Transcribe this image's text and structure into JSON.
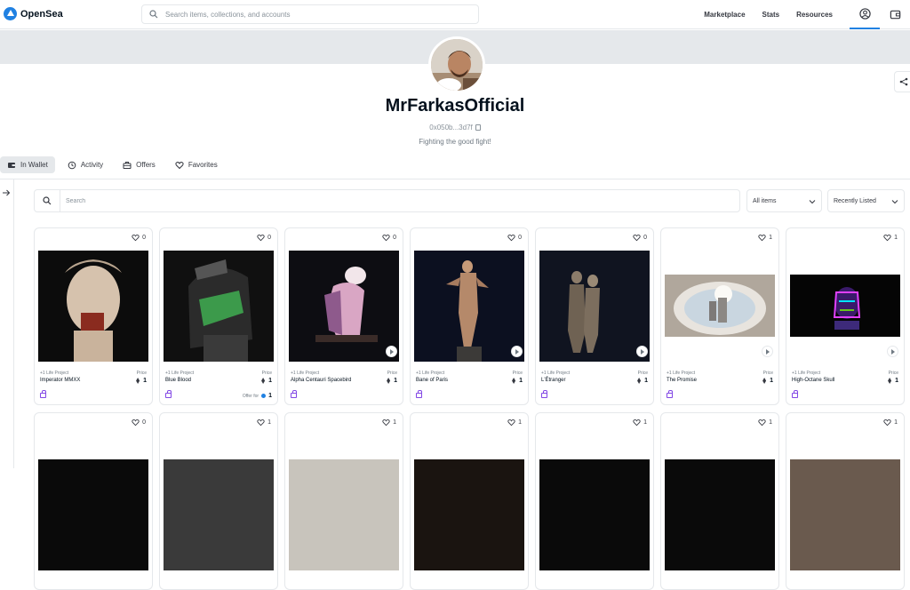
{
  "nav": {
    "logo_text": "OpenSea",
    "search_placeholder": "Search items, collections, and accounts",
    "links": [
      "Marketplace",
      "Stats",
      "Resources"
    ]
  },
  "profile": {
    "username": "MrFarkasOfficial",
    "address": "0x050b...3d7f",
    "bio": "Fighting the good fight!"
  },
  "tabs": [
    {
      "label": "In Wallet",
      "icon": "wallet-icon",
      "active": true
    },
    {
      "label": "Activity",
      "icon": "history-icon"
    },
    {
      "label": "Offers",
      "icon": "offers-icon"
    },
    {
      "label": "Favorites",
      "icon": "heart-icon"
    }
  ],
  "filters": {
    "search_placeholder": "Search",
    "items_dropdown": "All items",
    "sort_dropdown": "Recently Listed"
  },
  "cards": [
    {
      "collection": "+1 Life Project",
      "name": "Imperator MMXX",
      "price_label": "Price",
      "price": "1",
      "favorites": "0",
      "video": false
    },
    {
      "collection": "+1 Life Project",
      "name": "Blue Blood",
      "price_label": "Price",
      "price": "1",
      "favorites": "0",
      "video": false,
      "offer_label": "Offer for",
      "offer_value": "1"
    },
    {
      "collection": "+1 Life Project",
      "name": "Alpha Centauri Spacebird",
      "price_label": "Price",
      "price": "1",
      "favorites": "0",
      "video": true
    },
    {
      "collection": "+1 Life Project",
      "name": "Bane of Paris",
      "price_label": "Price",
      "price": "1",
      "favorites": "0",
      "video": true
    },
    {
      "collection": "+1 Life Project",
      "name": "L'Étranger",
      "price_label": "Price",
      "price": "1",
      "favorites": "0",
      "video": true
    },
    {
      "collection": "+1 Life Project",
      "name": "The Promise",
      "price_label": "Price",
      "price": "1",
      "favorites": "1",
      "video": true
    },
    {
      "collection": "+1 Life Project",
      "name": "High-Octane Skull",
      "price_label": "Price",
      "price": "1",
      "favorites": "1",
      "video": true
    }
  ],
  "second_row_favorites": [
    "0",
    "1",
    "1",
    "1",
    "1",
    "1",
    "1"
  ],
  "colors": {
    "accent": "#2081e2",
    "border": "#e5e8eb",
    "banner": "#e5e8eb",
    "lock": "#8247e5"
  }
}
